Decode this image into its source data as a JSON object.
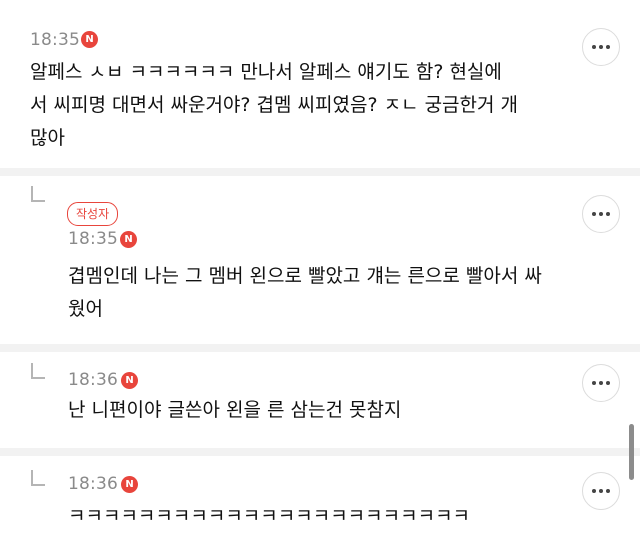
{
  "comments": [
    {
      "time": "18:35",
      "badge": "N",
      "lines": [
        "알페스 ㅅㅂ ㅋㅋㅋㅋㅋㅋ 만나서 알페스 얘기도 함? 현실에",
        "서 씨피명 대면서 싸운거야? 겹멤 씨피였음? ㅈㄴ 궁금한거 개",
        "많아"
      ]
    },
    {
      "time": "18:35",
      "badge": "N",
      "author_badge": "작성자",
      "lines": [
        "겹멤인데 나는 그 멤버 왼으로 빨았고 걔는 른으로 빨아서 싸",
        "웠어"
      ]
    },
    {
      "time": "18:36",
      "badge": "N",
      "lines": [
        "난 니편이야 글쓴아 왼을 른 삼는건 못참지"
      ]
    },
    {
      "time": "18:36",
      "badge": "N",
      "lines": [
        "ㅋㅋㅋㅋㅋㅋㅋㅋㅋㅋㅋㅋㅋㅋㅋㅋㅋㅋㅋㅋㅋㅋㅋ"
      ]
    }
  ]
}
